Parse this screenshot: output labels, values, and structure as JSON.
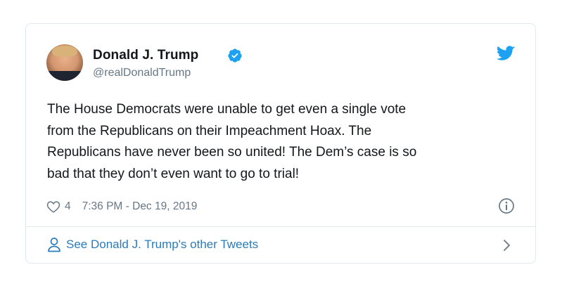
{
  "tweet": {
    "author_name": "Donald J. Trump",
    "handle": "@realDonaldTrump",
    "text": "The House Democrats were unable to get even a single vote\nfrom the Republicans on their Impeachment Hoax. The\nRepublicans have never been so united!  The Dem’s case is so\nbad that they don’t even want to go to trial!",
    "likes": "4",
    "timestamp": "7:36 PM - Dec 19, 2019"
  },
  "footer": {
    "link_label": "See Donald J. Trump's other Tweets"
  },
  "icons": {
    "verified": "verified-badge-icon",
    "brand": "twitter-bird-icon",
    "like": "heart-icon",
    "info": "info-icon",
    "person": "person-icon",
    "chevron": "chevron-right-icon"
  },
  "colors": {
    "brand_blue": "#1da1f2",
    "link_blue": "#2b7bb9",
    "text": "#14171a",
    "muted": "#657786",
    "border": "#e1e8ed"
  }
}
